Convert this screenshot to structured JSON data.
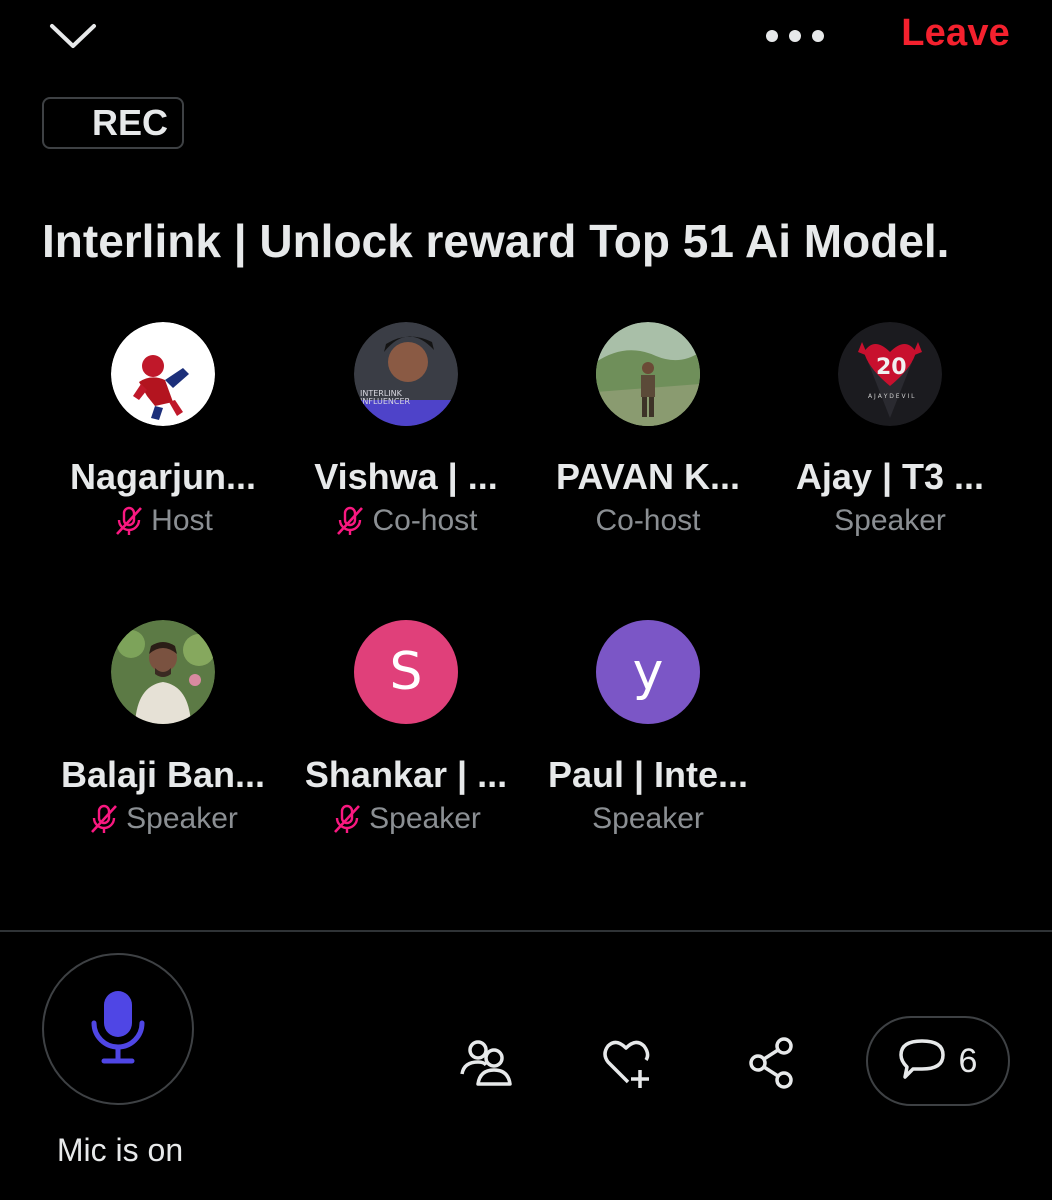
{
  "header": {
    "collapse_icon": "chevron-down-icon",
    "more_icon": "more-horizontal-icon",
    "leave_label": "Leave",
    "leave_color": "#f4212e"
  },
  "recording": {
    "label": "REC"
  },
  "space": {
    "title": "Interlink | Unlock reward Top 51 Ai Model."
  },
  "participants": [
    {
      "name": "Nagarjun...",
      "role": "Host",
      "muted": true,
      "avatar": "photo"
    },
    {
      "name": "Vishwa | ...",
      "role": "Co-host",
      "muted": true,
      "avatar": "photo"
    },
    {
      "name": "PAVAN K...",
      "role": "Co-host",
      "muted": false,
      "avatar": "photo"
    },
    {
      "name": "Ajay | T3 ...",
      "role": "Speaker",
      "muted": false,
      "avatar": "photo"
    },
    {
      "name": "Balaji Ban...",
      "role": "Speaker",
      "muted": true,
      "avatar": "photo"
    },
    {
      "name": "Shankar | ...",
      "role": "Speaker",
      "muted": true,
      "avatar_letter": "S",
      "avatar_color": "#e0407a"
    },
    {
      "name": "Paul | Inte...",
      "role": "Speaker",
      "muted": false,
      "avatar_letter": "y",
      "avatar_color": "#7b56c6"
    }
  ],
  "footer": {
    "mic_status": "Mic is on",
    "mic_icon": "microphone-icon",
    "mic_color": "#4f46e5",
    "people_icon": "people-icon",
    "like_icon": "heart-plus-icon",
    "share_icon": "share-icon",
    "comment_icon": "comment-bubble-icon",
    "comments_count": "6"
  },
  "colors": {
    "background": "#000000",
    "muted_icon": "#f91880",
    "secondary_text": "#8b8f93"
  }
}
